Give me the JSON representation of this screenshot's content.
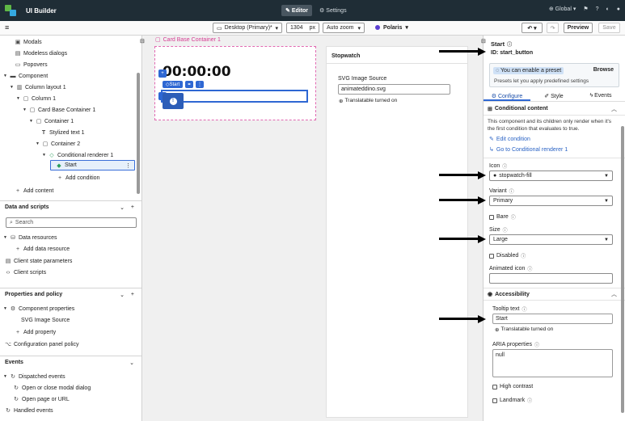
{
  "app": {
    "title": "UI Builder"
  },
  "topnav": {
    "editor": "Editor",
    "settings": "Settings",
    "global": "Global"
  },
  "toolbar": {
    "device": "Desktop (Primary)*",
    "width": "1304",
    "width_unit": "px",
    "zoom": "Auto zoom",
    "theme": "Polaris",
    "preview": "Preview",
    "save": "Save"
  },
  "left": {
    "tree": [
      {
        "label": "Modals",
        "icon": "▣"
      },
      {
        "label": "Modeless dialogs",
        "icon": "▤"
      },
      {
        "label": "Popovers",
        "icon": "▭"
      },
      {
        "label": "Component",
        "icon": "▬"
      },
      {
        "label": "Column layout 1",
        "icon": "▥"
      },
      {
        "label": "Column 1",
        "icon": "▢"
      },
      {
        "label": "Card Base Container 1",
        "icon": "▢"
      },
      {
        "label": "Container 1",
        "icon": "▢"
      },
      {
        "label": "Stylized text 1",
        "icon": "T"
      },
      {
        "label": "Container 2",
        "icon": "▢"
      },
      {
        "label": "Conditional renderer 1",
        "icon": "◇"
      },
      {
        "label": "Start",
        "icon": "◆"
      },
      {
        "label": "Add condition",
        "icon": "+"
      },
      {
        "label": "Add content",
        "icon": "+"
      }
    ],
    "data_section": "Data and scripts",
    "search_placeholder": "Search",
    "data_items": [
      {
        "label": "Data resources"
      },
      {
        "label": "Add data resource"
      },
      {
        "label": "Client state parameters"
      },
      {
        "label": "Client scripts"
      }
    ],
    "props_section": "Properties and policy",
    "props_items": [
      {
        "label": "Component properties"
      },
      {
        "label": "SVG Image Source"
      },
      {
        "label": "Add property"
      },
      {
        "label": "Configuration panel policy"
      }
    ],
    "events_section": "Events",
    "events_items": [
      {
        "label": "Dispatched events"
      },
      {
        "label": "Open or close modal dialog"
      },
      {
        "label": "Open page or URL"
      },
      {
        "label": "Handled events"
      }
    ]
  },
  "canvas": {
    "frame_label": "Card Base Container 1",
    "clock": "00:00:00",
    "chip_start": "Start",
    "stopwatch_title": "Stopwatch",
    "svg_label": "SVG Image Source",
    "svg_value": "animateddino.svg",
    "translatable": "Translatable turned on"
  },
  "right": {
    "title": "Start",
    "id_line": "ID: start_button",
    "preset_badge": "You can enable a preset",
    "browse": "Browse",
    "preset_desc": "Presets let you apply predefined settings",
    "tabs": [
      "Configure",
      "Style",
      "Events"
    ],
    "cond_section": "Conditional content",
    "cond_desc": "This component and its children only render when it's the first condition that evaluates to true.",
    "edit_condition": "Edit condition",
    "goto_renderer": "Go to Conditional renderer 1",
    "icon_label": "Icon",
    "icon_value": "stopwatch-fill",
    "variant_label": "Variant",
    "variant_value": "Primary",
    "bare_label": "Bare",
    "size_label": "Size",
    "size_value": "Large",
    "disabled_label": "Disabled",
    "animated_icon_label": "Animated icon",
    "access_section": "Accessibility",
    "tooltip_label": "Tooltip text",
    "tooltip_value": "Start",
    "translatable": "Translatable turned on",
    "aria_label": "ARIA properties",
    "aria_value": "null",
    "high_contrast": "High contrast",
    "landmark": "Landmark"
  },
  "colors": {
    "topbar": "#1f2d36",
    "accent": "#2e67d3",
    "frame_border": "#e16ab2",
    "theme_dot": "#5b3fd1"
  }
}
